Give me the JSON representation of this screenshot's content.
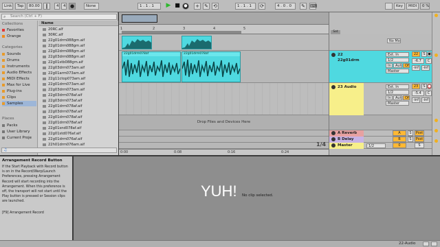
{
  "transport": {
    "link": "Link",
    "tap": "Tap",
    "tempo": "80.00",
    "sig_num": "4",
    "sig_den": "4",
    "quant": "None",
    "position": "1 . 1 . 1",
    "loop_start": "1 . 1 . 1",
    "loop_len": "4 . 0 . 0",
    "key": "Key",
    "midi": "MIDI",
    "cpu": "0 %",
    "counter_left": "1 . 1 . 1"
  },
  "browser": {
    "search_placeholder": "Search (Ctrl + F)",
    "collections_header": "Collections",
    "collections": [
      {
        "label": "Favorites",
        "color": "#e03a3a"
      },
      {
        "label": "Orange",
        "color": "#f08a1a"
      }
    ],
    "categories_header": "Categories",
    "categories": [
      "Sounds",
      "Drums",
      "Instruments",
      "Audio Effects",
      "MIDI Effects",
      "Max for Live",
      "Plug-ins",
      "Clips",
      "Samples"
    ],
    "selected_category": "Samples",
    "places_header": "Places",
    "places": [
      "Packs",
      "User Library",
      "Current Proje"
    ],
    "name_header": "Name",
    "files": [
      "20RC.alf",
      "30RC.alf",
      "22g01drm088gm.aif",
      "22g01drm088gm.aif",
      "22g02drm088gm.aif",
      "22g03drm088gm.aif",
      "22g01stb088gm.aif",
      "22g03drm073am.aif",
      "22g01arm073am.aif",
      "22g11ctop073am.aif",
      "22g01drm073am.aif",
      "22g03drm073am.aif",
      "22g03drm078af.aif",
      "22g03drm073af.aif",
      "22g01drm078af.aif",
      "22g03drm078af.aif",
      "22g01drm078af.aif",
      "22g01drm078af.aif",
      "22g01snd078af.aif",
      "22g01std076af.aif",
      "22g01drm076af.aif",
      "22h01drm076am.aif",
      "22h01drm076am.aif"
    ]
  },
  "arrangement": {
    "ruler_marks": [
      "1",
      "2",
      "3",
      "4",
      "5"
    ],
    "time_marks": [
      "0:00",
      "0:08",
      "0:16",
      "0:24"
    ],
    "clip1_name": "22g01drm078af",
    "clip2_name": "22g01drm078af",
    "drop_text": "Drop Files and Devices Here",
    "zoom_label": "1/4"
  },
  "mixer": {
    "set_label": "Set",
    "tracks": [
      {
        "name": "22 22g01drm",
        "color": "#4fd9e0",
        "input": "Ext. In",
        "chan": "1/2",
        "monitor_in": "In",
        "monitor_auto": "Auto",
        "monitor_off": "Off",
        "out": "Master",
        "track_num": "22",
        "vol": "-6.7",
        "pan": "C",
        "peak1": "-inf",
        "peak2": "-inf"
      },
      {
        "name": "23 Audio",
        "color": "#f7ef8a",
        "input": "Ext. In",
        "chan": "1/2",
        "monitor_in": "In",
        "monitor_auto": "Auto",
        "monitor_off": "Off",
        "out": "Master",
        "track_num": "23",
        "vol": "-5.4",
        "pan": "C",
        "peak1": "-inf",
        "peak2": "-inf"
      }
    ],
    "returns": [
      {
        "name": "A Reverb",
        "color": "#e7a1a1",
        "letter": "A",
        "post": "Post"
      },
      {
        "name": "B Delay",
        "color": "#c7b3e6",
        "letter": "B",
        "post": "Post"
      }
    ],
    "master": {
      "name": "Master",
      "color": "#f7ef8a",
      "ratio": "1/2",
      "num": "0"
    }
  },
  "info": {
    "title": "Arrangement Record Button",
    "body": "If the Start Playback with Record button is on in the Record/Warp/Launch Preferences, pressing Arrangement Record will start recording into the Arrangement. When this preference is off, the transport will not start until the Play button is pressed or Session clips are launched.",
    "shortcut": "[F9] Arrangement Record"
  },
  "detail": {
    "overlay_text": "YUH!",
    "no_clip": "No clip selected."
  },
  "status": {
    "track_label": "22-Audio"
  },
  "colors": {
    "accent_clip": "#4fd9e0",
    "record": "#e03a3a",
    "transport_yellow": "#ffb833"
  }
}
